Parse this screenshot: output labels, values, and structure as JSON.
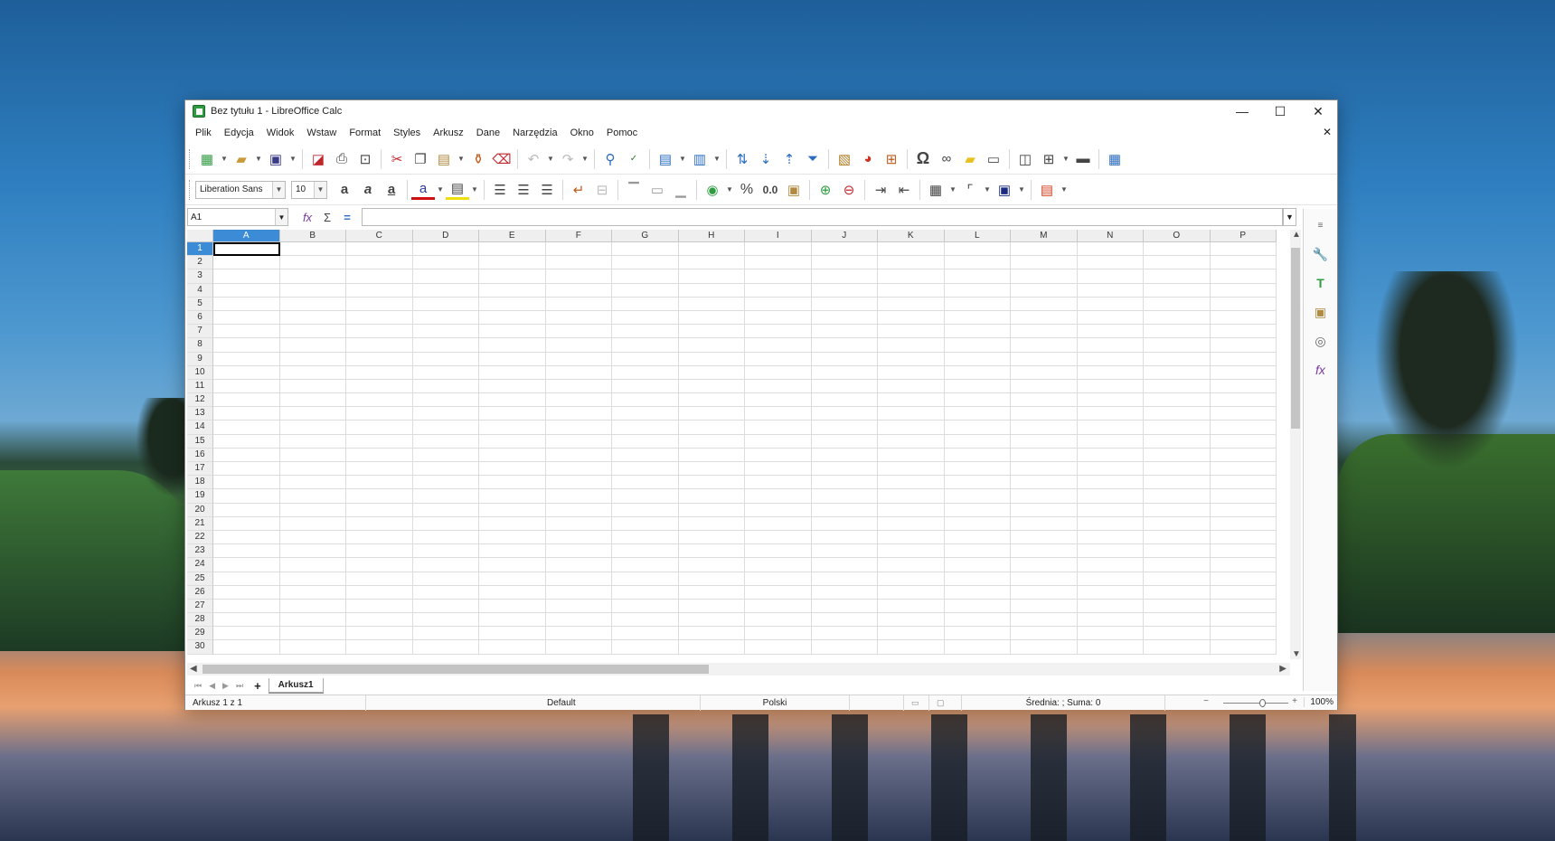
{
  "window": {
    "title": "Bez tytułu 1 - LibreOffice Calc",
    "minimize": "—",
    "maximize": "☐",
    "close": "✕"
  },
  "menu": {
    "items": [
      "Plik",
      "Edycja",
      "Widok",
      "Wstaw",
      "Format",
      "Styles",
      "Arkusz",
      "Dane",
      "Narzędzia",
      "Okno",
      "Pomoc"
    ],
    "close": "✕"
  },
  "formatting": {
    "font_name": "Liberation Sans",
    "font_size": "10",
    "percent": "%",
    "number_format": "0.0"
  },
  "formula": {
    "name_box": "A1",
    "value": ""
  },
  "columns": [
    "A",
    "B",
    "C",
    "D",
    "E",
    "F",
    "G",
    "H",
    "I",
    "J",
    "K",
    "L",
    "M",
    "N",
    "O",
    "P"
  ],
  "rows": [
    "1",
    "2",
    "3",
    "4",
    "5",
    "6",
    "7",
    "8",
    "9",
    "10",
    "11",
    "12",
    "13",
    "14",
    "15",
    "16",
    "17",
    "18",
    "19",
    "20",
    "21",
    "22",
    "23",
    "24",
    "25",
    "26",
    "27",
    "28",
    "29",
    "30"
  ],
  "active_cell": "A1",
  "sheets": {
    "tabs": [
      "Arkusz1"
    ],
    "add_label": "+"
  },
  "status": {
    "sheet_info": "Arkusz 1 z 1",
    "page_style": "Default",
    "language": "Polski",
    "selection_stats": "Średnia: ; Suma: 0",
    "zoom": "100%"
  },
  "colors": {
    "accent": "#3c8bd6",
    "header_bg": "#efefef",
    "grid": "#dcdcdc",
    "app_icon": "#2e9b40"
  }
}
